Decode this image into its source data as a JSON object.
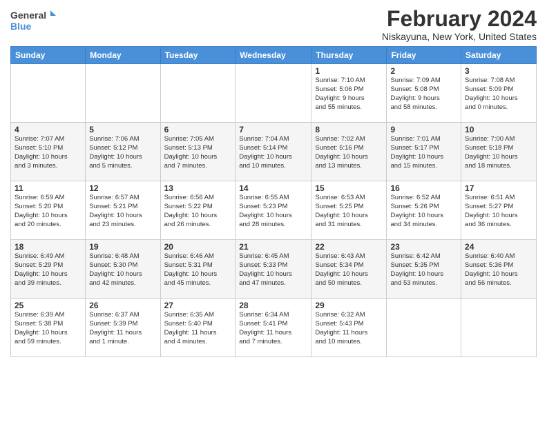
{
  "header": {
    "logo_general": "General",
    "logo_blue": "Blue",
    "month_year": "February 2024",
    "location": "Niskayuna, New York, United States"
  },
  "columns": [
    "Sunday",
    "Monday",
    "Tuesday",
    "Wednesday",
    "Thursday",
    "Friday",
    "Saturday"
  ],
  "weeks": [
    {
      "days": [
        {
          "num": "",
          "info": ""
        },
        {
          "num": "",
          "info": ""
        },
        {
          "num": "",
          "info": ""
        },
        {
          "num": "",
          "info": ""
        },
        {
          "num": "1",
          "info": "Sunrise: 7:10 AM\nSunset: 5:06 PM\nDaylight: 9 hours\nand 55 minutes."
        },
        {
          "num": "2",
          "info": "Sunrise: 7:09 AM\nSunset: 5:08 PM\nDaylight: 9 hours\nand 58 minutes."
        },
        {
          "num": "3",
          "info": "Sunrise: 7:08 AM\nSunset: 5:09 PM\nDaylight: 10 hours\nand 0 minutes."
        }
      ]
    },
    {
      "days": [
        {
          "num": "4",
          "info": "Sunrise: 7:07 AM\nSunset: 5:10 PM\nDaylight: 10 hours\nand 3 minutes."
        },
        {
          "num": "5",
          "info": "Sunrise: 7:06 AM\nSunset: 5:12 PM\nDaylight: 10 hours\nand 5 minutes."
        },
        {
          "num": "6",
          "info": "Sunrise: 7:05 AM\nSunset: 5:13 PM\nDaylight: 10 hours\nand 7 minutes."
        },
        {
          "num": "7",
          "info": "Sunrise: 7:04 AM\nSunset: 5:14 PM\nDaylight: 10 hours\nand 10 minutes."
        },
        {
          "num": "8",
          "info": "Sunrise: 7:02 AM\nSunset: 5:16 PM\nDaylight: 10 hours\nand 13 minutes."
        },
        {
          "num": "9",
          "info": "Sunrise: 7:01 AM\nSunset: 5:17 PM\nDaylight: 10 hours\nand 15 minutes."
        },
        {
          "num": "10",
          "info": "Sunrise: 7:00 AM\nSunset: 5:18 PM\nDaylight: 10 hours\nand 18 minutes."
        }
      ]
    },
    {
      "days": [
        {
          "num": "11",
          "info": "Sunrise: 6:59 AM\nSunset: 5:20 PM\nDaylight: 10 hours\nand 20 minutes."
        },
        {
          "num": "12",
          "info": "Sunrise: 6:57 AM\nSunset: 5:21 PM\nDaylight: 10 hours\nand 23 minutes."
        },
        {
          "num": "13",
          "info": "Sunrise: 6:56 AM\nSunset: 5:22 PM\nDaylight: 10 hours\nand 26 minutes."
        },
        {
          "num": "14",
          "info": "Sunrise: 6:55 AM\nSunset: 5:23 PM\nDaylight: 10 hours\nand 28 minutes."
        },
        {
          "num": "15",
          "info": "Sunrise: 6:53 AM\nSunset: 5:25 PM\nDaylight: 10 hours\nand 31 minutes."
        },
        {
          "num": "16",
          "info": "Sunrise: 6:52 AM\nSunset: 5:26 PM\nDaylight: 10 hours\nand 34 minutes."
        },
        {
          "num": "17",
          "info": "Sunrise: 6:51 AM\nSunset: 5:27 PM\nDaylight: 10 hours\nand 36 minutes."
        }
      ]
    },
    {
      "days": [
        {
          "num": "18",
          "info": "Sunrise: 6:49 AM\nSunset: 5:29 PM\nDaylight: 10 hours\nand 39 minutes."
        },
        {
          "num": "19",
          "info": "Sunrise: 6:48 AM\nSunset: 5:30 PM\nDaylight: 10 hours\nand 42 minutes."
        },
        {
          "num": "20",
          "info": "Sunrise: 6:46 AM\nSunset: 5:31 PM\nDaylight: 10 hours\nand 45 minutes."
        },
        {
          "num": "21",
          "info": "Sunrise: 6:45 AM\nSunset: 5:33 PM\nDaylight: 10 hours\nand 47 minutes."
        },
        {
          "num": "22",
          "info": "Sunrise: 6:43 AM\nSunset: 5:34 PM\nDaylight: 10 hours\nand 50 minutes."
        },
        {
          "num": "23",
          "info": "Sunrise: 6:42 AM\nSunset: 5:35 PM\nDaylight: 10 hours\nand 53 minutes."
        },
        {
          "num": "24",
          "info": "Sunrise: 6:40 AM\nSunset: 5:36 PM\nDaylight: 10 hours\nand 56 minutes."
        }
      ]
    },
    {
      "days": [
        {
          "num": "25",
          "info": "Sunrise: 6:39 AM\nSunset: 5:38 PM\nDaylight: 10 hours\nand 59 minutes."
        },
        {
          "num": "26",
          "info": "Sunrise: 6:37 AM\nSunset: 5:39 PM\nDaylight: 11 hours\nand 1 minute."
        },
        {
          "num": "27",
          "info": "Sunrise: 6:35 AM\nSunset: 5:40 PM\nDaylight: 11 hours\nand 4 minutes."
        },
        {
          "num": "28",
          "info": "Sunrise: 6:34 AM\nSunset: 5:41 PM\nDaylight: 11 hours\nand 7 minutes."
        },
        {
          "num": "29",
          "info": "Sunrise: 6:32 AM\nSunset: 5:43 PM\nDaylight: 11 hours\nand 10 minutes."
        },
        {
          "num": "",
          "info": ""
        },
        {
          "num": "",
          "info": ""
        }
      ]
    }
  ]
}
